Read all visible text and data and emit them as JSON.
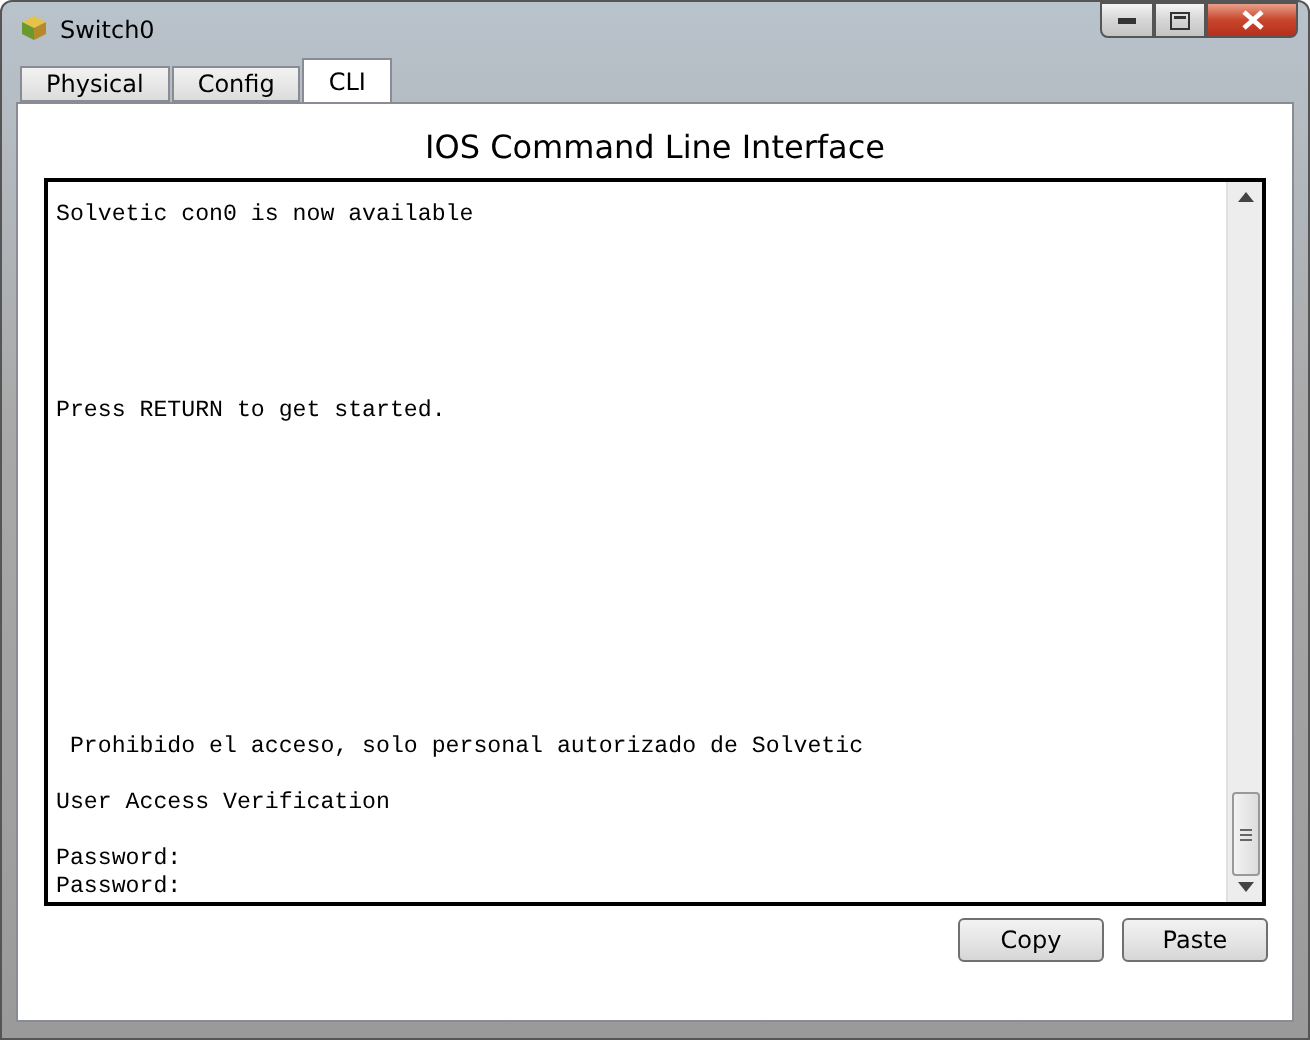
{
  "window": {
    "title": "Switch0"
  },
  "tabs": [
    {
      "label": "Physical",
      "selected": false
    },
    {
      "label": "Config",
      "selected": false
    },
    {
      "label": "CLI",
      "selected": true
    }
  ],
  "heading": "IOS Command Line Interface",
  "terminal": {
    "lines": [
      "Solvetic con0 is now available",
      "Press RETURN to get started.",
      " Prohibido el acceso, solo personal autorizado de Solvetic",
      "User Access Verification",
      "Password:",
      "Password:"
    ]
  },
  "buttons": [
    "Copy",
    "Paste"
  ]
}
